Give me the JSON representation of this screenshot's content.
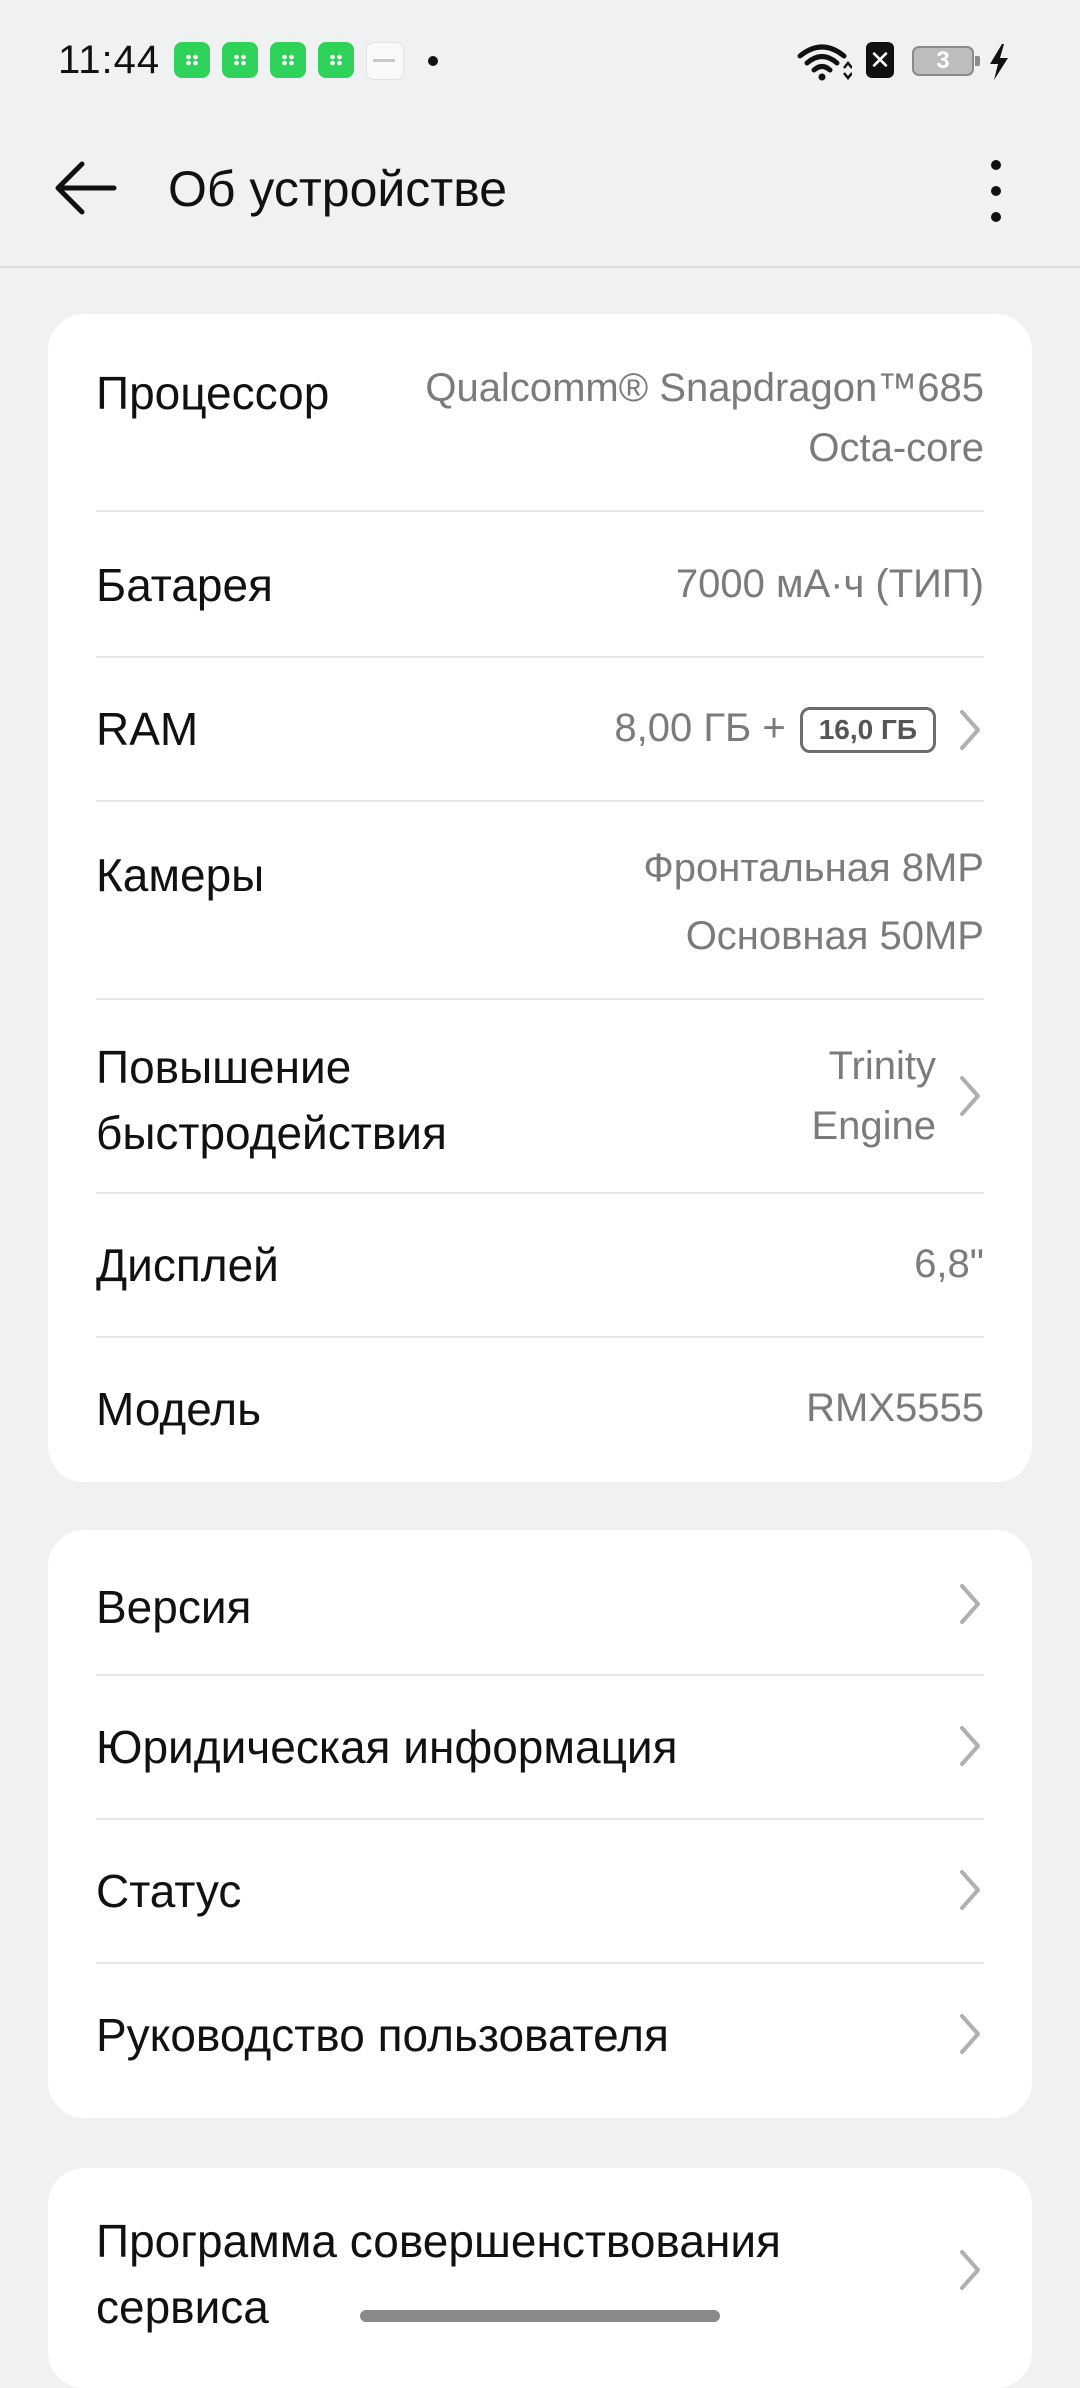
{
  "status_bar": {
    "time": "11:44",
    "sim_label": "✕",
    "battery_level": "3",
    "notification_icons": [
      "market-app-icon",
      "market-app-icon",
      "market-app-icon",
      "market-app-icon",
      "realme-app-icon"
    ],
    "accent_color": "#2fd35a"
  },
  "header": {
    "title": "Об устройстве",
    "back_icon": "arrow-left-icon",
    "menu_icon": "more-vertical-icon"
  },
  "specs_card": {
    "processor": {
      "label": "Процессор",
      "value_line1": "Qualcomm® Snapdragon™685",
      "value_line2": "Octa-core"
    },
    "battery": {
      "label": "Батарея",
      "value": "7000 мА·ч (ТИП)"
    },
    "ram": {
      "label": "RAM",
      "value": "8,00 ГБ +",
      "badge": "16,0 ГБ"
    },
    "cameras": {
      "label": "Камеры",
      "value_line1": "Фронтальная 8MP",
      "value_line2": "Основная 50MP"
    },
    "performance": {
      "label_line1": "Повышение",
      "label_line2": "быстродействия",
      "value_line1": "Trinity",
      "value_line2": "Engine"
    },
    "display": {
      "label": "Дисплей",
      "value": "6,8\""
    },
    "model": {
      "label": "Модель",
      "value": "RMX5555"
    }
  },
  "info_card": {
    "items": [
      {
        "label": "Версия"
      },
      {
        "label": "Юридическая информация"
      },
      {
        "label": "Статус"
      },
      {
        "label": "Руководство пользователя"
      }
    ]
  },
  "program_card": {
    "label_line1": "Программа совершенствования",
    "label_line2": "сервиса"
  }
}
